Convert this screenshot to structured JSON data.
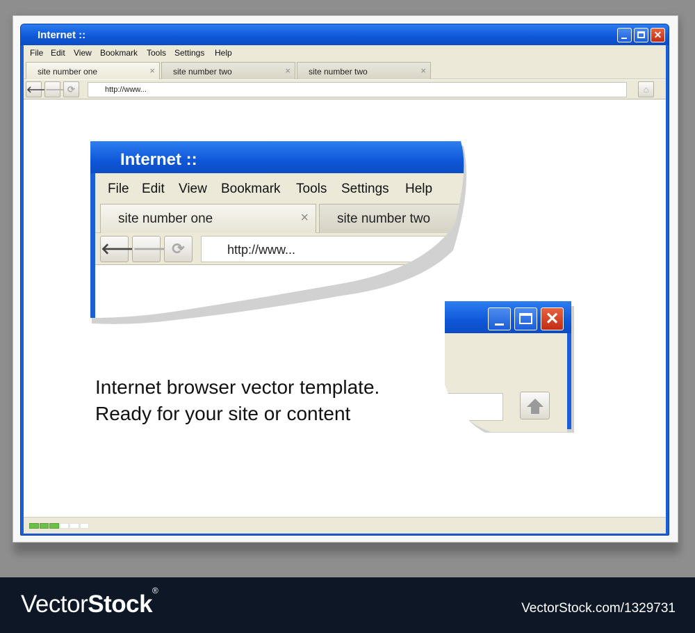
{
  "window": {
    "title": "Internet ::",
    "menu": [
      "File",
      "Edit",
      "View",
      "Bookmark",
      "Tools",
      "Settings",
      "Help"
    ],
    "tabs": [
      {
        "label": "site number one",
        "close": "×"
      },
      {
        "label": "site number two",
        "close": "×"
      },
      {
        "label": "site number two",
        "close": "×"
      }
    ],
    "nav": {
      "back": "🡐",
      "forward": "🡒",
      "reload": "⟳",
      "url": "http://www...",
      "home": "⌂"
    },
    "status": {
      "progress_segments_total": 6,
      "progress_segments_filled": 3
    },
    "controls": {
      "close": "✕"
    }
  },
  "zoom": {
    "title": "Internet ::",
    "menu": [
      "File",
      "Edit",
      "View",
      "Bookmark",
      "Tools",
      "Settings",
      "Help"
    ],
    "tabs": [
      {
        "label": "site number one",
        "close": "×"
      },
      {
        "label": "site number two"
      }
    ],
    "url": "http://www...",
    "mini_close": "✕"
  },
  "caption": {
    "line1": "Internet browser vector template.",
    "line2": "Ready for your site or content"
  },
  "footer": {
    "brand_light": "Vector",
    "brand_bold": "Stock",
    "brand_mark": "®",
    "id": "VectorStock.com/1329731"
  },
  "colors": {
    "accent": "#0f58d9",
    "chrome": "#ece9d8",
    "progress": "#6cc04a",
    "close_red": "#c22c14"
  }
}
